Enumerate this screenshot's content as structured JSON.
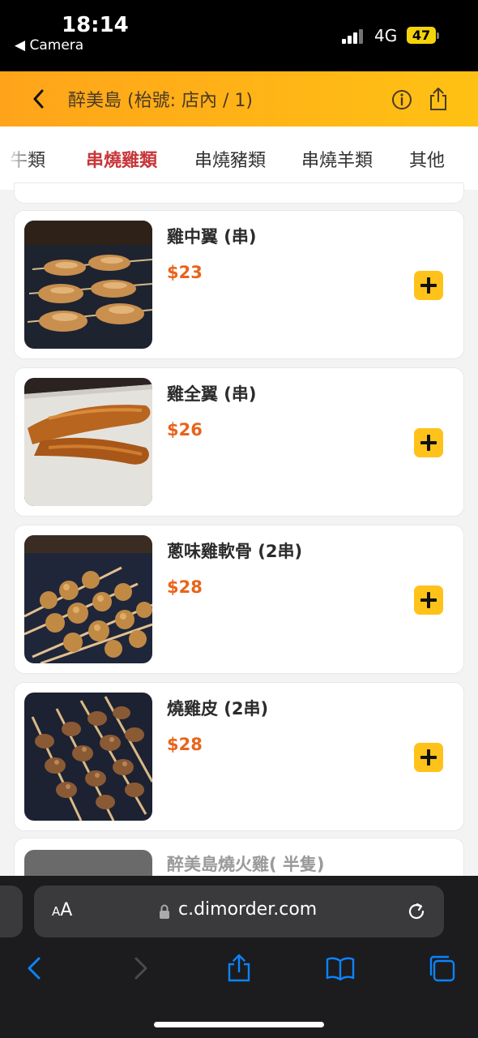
{
  "status": {
    "time": "18:14",
    "back_app": "◀ Camera",
    "network": "4G",
    "battery": "47"
  },
  "header": {
    "title": "醉美島 (枱號: 店內 / 1)"
  },
  "tabs": {
    "items": [
      "牛類",
      "串燒雞類",
      "串燒豬類",
      "串燒羊類",
      "其他"
    ]
  },
  "items": [
    {
      "name": "雞中翼 (串)",
      "price": "$23"
    },
    {
      "name": "雞全翼 (串)",
      "price": "$26"
    },
    {
      "name": "蔥味雞軟骨 (2串)",
      "price": "$28"
    },
    {
      "name": "燒雞皮 (2串)",
      "price": "$28"
    },
    {
      "name": "醉美島燒火雞( 半隻)"
    }
  ],
  "browser": {
    "aa_small": "A",
    "aa_large": "A",
    "url": "c.dimorder.com"
  },
  "colors": {
    "accent": "#ffb316",
    "active_tab": "#c7373a",
    "price": "#e8641b",
    "add_button": "#ffc21a"
  }
}
